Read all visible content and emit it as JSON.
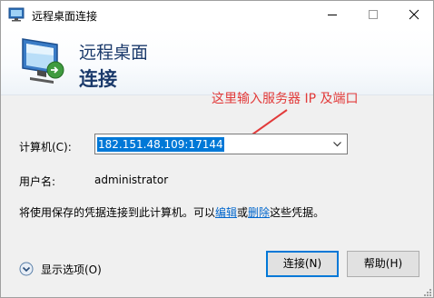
{
  "window": {
    "title": "远程桌面连接",
    "controls": {
      "minimize": "minimize-icon",
      "maximize": "maximize-icon",
      "close": "close-icon"
    }
  },
  "header": {
    "line1": "远程桌面",
    "line2": "连接",
    "icon": "remote-desktop-monitor-icon"
  },
  "annotation": {
    "text": "这里输入服务器 IP 及端口",
    "color": "#e23a3a"
  },
  "form": {
    "computer_label": "计算机(C):",
    "computer_value": "182.151.48.109:17144",
    "username_label": "用户名:",
    "username_value": "administrator",
    "credentials": {
      "prefix": "将使用保存的凭据连接到此计算机。可以",
      "edit_link": "编辑",
      "or": "或",
      "delete_link": "删除",
      "suffix": "这些凭据。"
    }
  },
  "footer": {
    "options_label": "显示选项(O)",
    "connect_label": "连接(N)",
    "help_label": "帮助(H)"
  },
  "colors": {
    "accent": "#0078d7",
    "header_text": "#1b3a6b",
    "link": "#0066cc"
  }
}
